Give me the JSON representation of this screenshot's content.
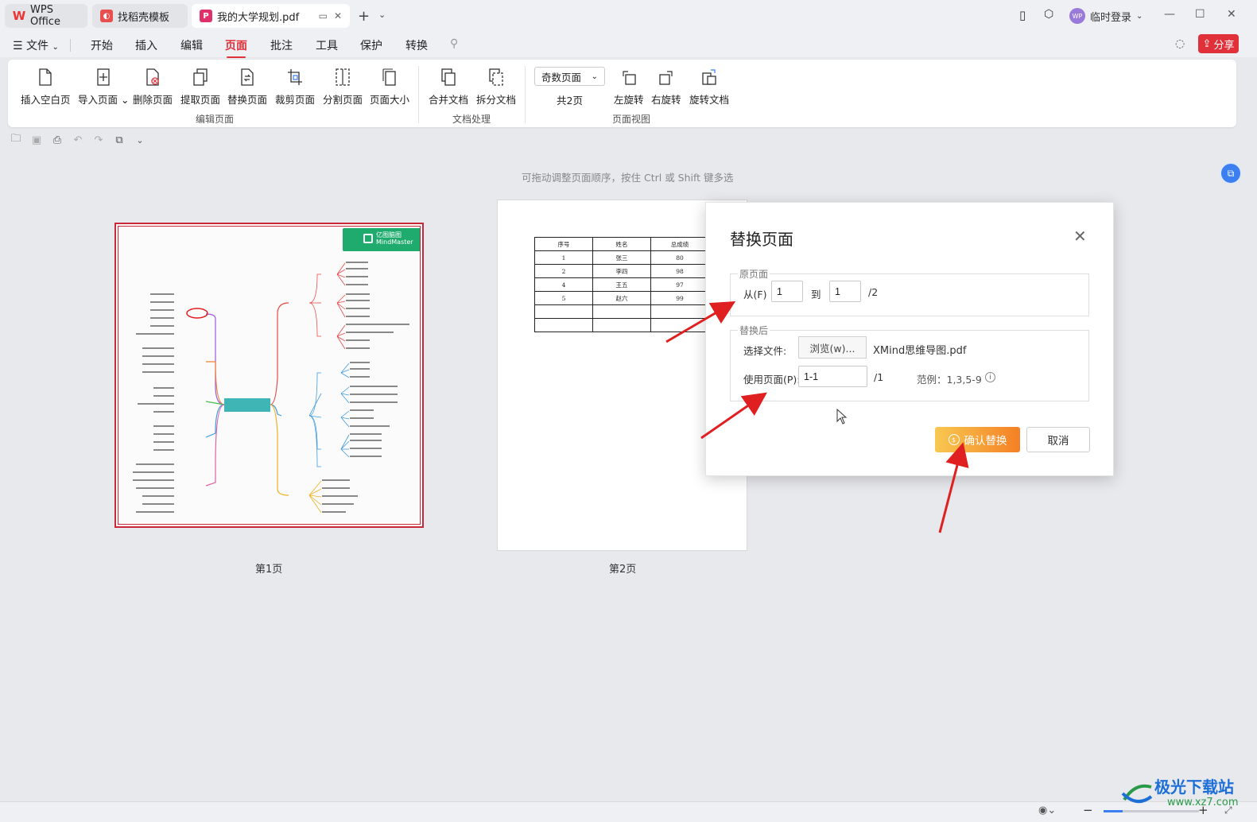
{
  "titlebar": {
    "tabs": [
      {
        "label": "WPS Office"
      },
      {
        "label": "找稻壳模板"
      },
      {
        "label": "我的大学规划.pdf"
      }
    ],
    "login_label": "临时登录",
    "avatar_text": "WP"
  },
  "menubar": {
    "file_label": "文件",
    "items": [
      "开始",
      "插入",
      "编辑",
      "页面",
      "批注",
      "工具",
      "保护",
      "转换"
    ],
    "active": "页面",
    "share_label": "分享"
  },
  "ribbon": {
    "edit_group": {
      "label": "编辑页面",
      "buttons": [
        "插入空白页",
        "导入页面",
        "删除页面",
        "提取页面",
        "替换页面",
        "裁剪页面",
        "分割页面",
        "页面大小"
      ]
    },
    "doc_group": {
      "label": "文档处理",
      "buttons": [
        "合并文档",
        "拆分文档"
      ]
    },
    "view_group": {
      "label": "页面视图",
      "select_value": "奇数页面",
      "page_count": "共2页",
      "buttons": [
        "左旋转",
        "右旋转",
        "旋转文档"
      ]
    }
  },
  "hint": "可拖动调整页面顺序，按住 Ctrl 或 Shift 键多选",
  "pages": [
    {
      "label": "第1页"
    },
    {
      "label": "第2页"
    }
  ],
  "mindmap_logo": {
    "line1": "亿图脑图",
    "line2": "MindMaster"
  },
  "page2_table": {
    "headers": [
      "序号",
      "姓名",
      "总成绩"
    ],
    "rows": [
      [
        "1",
        "张三",
        "80"
      ],
      [
        "2",
        "李四",
        "98"
      ],
      [
        "4",
        "王五",
        "97"
      ],
      [
        "5",
        "赵六",
        "99"
      ],
      [
        "",
        "",
        ""
      ],
      [
        "",
        "",
        ""
      ]
    ]
  },
  "dialog": {
    "title": "替换页面",
    "original": {
      "legend": "原页面",
      "from_label": "从(F)",
      "from_value": "1",
      "to_label": "到",
      "to_value": "1",
      "total": "/2"
    },
    "after": {
      "legend": "替换后",
      "file_label": "选择文件:",
      "browse_label": "浏览(w)...",
      "file_name": "XMind思维导图.pdf",
      "pages_label": "使用页面(P):",
      "pages_value": "1-1",
      "pages_total": "/1",
      "example": "范例：1,3,5-9"
    },
    "confirm_label": "确认替换",
    "cancel_label": "取消"
  },
  "watermark": {
    "line1": "极光下载站",
    "line2": "www.xz7.com"
  },
  "colors": {
    "accent": "#e0303a",
    "confirm_start": "#f8c850",
    "confirm_end": "#f58025",
    "arrow": "#e02020"
  }
}
